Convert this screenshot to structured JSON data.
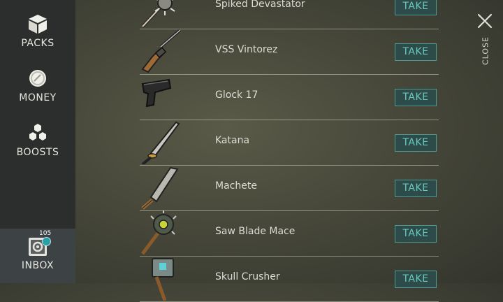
{
  "sidebar": {
    "items": [
      {
        "label": "PACKS",
        "icon": "cube-icon"
      },
      {
        "label": "MONEY",
        "icon": "coin-icon"
      },
      {
        "label": "BOOSTS",
        "icon": "hexagons-icon"
      },
      {
        "label": "INBOX",
        "icon": "safe-icon",
        "badge_count": "105"
      }
    ]
  },
  "close_label": "CLOSE",
  "take_label": "TAKE",
  "items": [
    {
      "name": "Spiked Devastator",
      "icon": "spiked-club-icon"
    },
    {
      "name": "VSS Vintorez",
      "icon": "rifle-icon"
    },
    {
      "name": "Glock 17",
      "icon": "pistol-icon"
    },
    {
      "name": "Katana",
      "icon": "katana-icon"
    },
    {
      "name": "Machete",
      "icon": "machete-icon"
    },
    {
      "name": "Saw Blade Mace",
      "icon": "saw-blade-mace-icon"
    },
    {
      "name": "Skull Crusher",
      "icon": "hammer-icon"
    }
  ],
  "colors": {
    "sidebar_bg": "#2b2e2c",
    "inbox_active_bg": "#3d4244",
    "take_button_bg": "#2d4b48",
    "take_button_text": "#69c9bf",
    "badge": "#2aa1a1"
  }
}
